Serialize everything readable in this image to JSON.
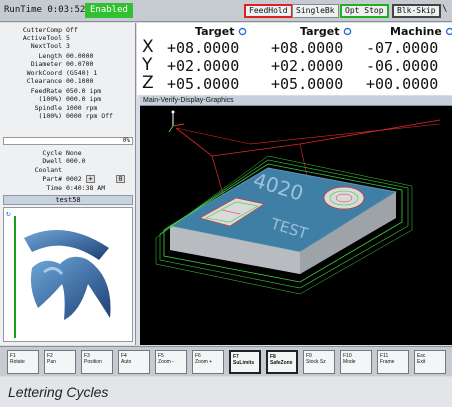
{
  "topbar": {
    "runtime": "RunTime 0:03:52",
    "status": "Enabled",
    "feedhold": "FeedHold",
    "singlebk": "SingleBk",
    "optstop": "Opt Stop",
    "blkskip": "Blk-Skip",
    "more": "\\"
  },
  "status": {
    "rows": [
      {
        "label": "CutterComp",
        "value": "Off"
      },
      {
        "label": "ActiveTool",
        "value": "5"
      },
      {
        "label": "NextTool",
        "value": "3"
      },
      {
        "label": "Length",
        "value": "00.0000"
      },
      {
        "label": "Diameter",
        "value": "00.0700"
      },
      {
        "label": "WorkCoord",
        "value": "(G540) 1"
      },
      {
        "label": "Clearance",
        "value": "00.1000"
      },
      {
        "label": "FeedRate",
        "value": "050.0 ipm"
      },
      {
        "label": "(100%)",
        "value": "000.0 ipm"
      },
      {
        "label": "Spindle",
        "value": "1000 rpm"
      },
      {
        "label": "(100%)",
        "value": "0000 rpm Off"
      }
    ],
    "progress_label": "0%",
    "progress": 0,
    "cycle_label": "Cycle",
    "cycle_value": "None",
    "dwell_label": "Dwell",
    "dwell_value": "000.0",
    "coolant_label": "Coolant",
    "part_label": "Part#",
    "part_value": "0002",
    "part_plus": "+",
    "part_zero": "0",
    "time_label": "Time",
    "time_value": "0:40:38 AM",
    "filename": "test58"
  },
  "coords": {
    "headers": [
      "Target",
      "Target",
      "Machine"
    ],
    "axes": [
      "X",
      "Y",
      "Z"
    ],
    "values": [
      [
        "+08.0000",
        "+08.0000",
        "-07.0000"
      ],
      [
        "+02.0000",
        "+02.0000",
        "-06.0000"
      ],
      [
        "+05.0000",
        "+05.0000",
        "+00.0000"
      ]
    ]
  },
  "graphics": {
    "title": "Main-Verify-Display-Graphics",
    "engraving_top": "4020",
    "engraving_bottom": "TEST"
  },
  "fkeys": [
    {
      "key": "F1",
      "label": "Rotate"
    },
    {
      "key": "F2",
      "label": "Pan"
    },
    {
      "key": "F3",
      "label": "Position"
    },
    {
      "key": "F4",
      "label": "Auto"
    },
    {
      "key": "F5",
      "label": "Zoom -"
    },
    {
      "key": "F6",
      "label": "Zoom +"
    },
    {
      "key": "F7",
      "label": "SuLimits"
    },
    {
      "key": "F8",
      "label": "SafeZone"
    },
    {
      "key": "F9",
      "label": "Stock Sz"
    },
    {
      "key": "F10",
      "label": "Mode"
    },
    {
      "key": "F11",
      "label": "Frame"
    },
    {
      "key": "Esc",
      "label": "Exit"
    }
  ],
  "caption": "Lettering Cycles",
  "colors": {
    "enabled": "#30c030",
    "feedhold_border": "#e02020",
    "optstop_border": "#20b020",
    "plate": "#3f7fa6",
    "toolpath_green": "#3cd03c",
    "toolpath_red": "#e02828"
  }
}
